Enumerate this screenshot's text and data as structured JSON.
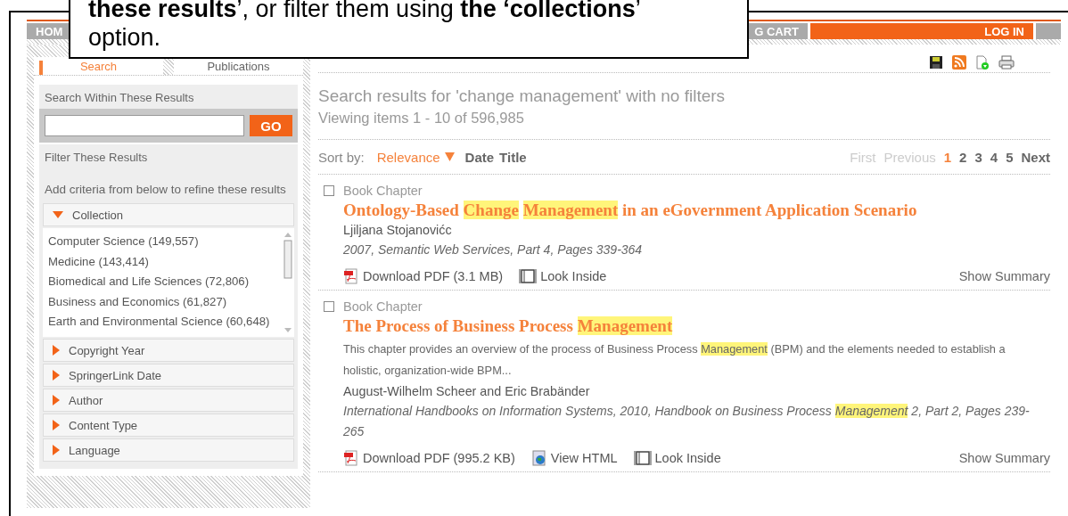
{
  "callout": {
    "text": "**these results**’, or filter them using **the ‘collections**’ option."
  },
  "nav": [
    {
      "label": "HOM",
      "kind": "plain"
    },
    {
      "label": "G CART",
      "kind": "plain"
    },
    {
      "label": "LOG IN",
      "kind": "accent"
    }
  ],
  "sidebar_tabs": [
    {
      "label": "Search",
      "selected": true
    },
    {
      "label": "Publications",
      "selected": false
    }
  ],
  "search_within": {
    "heading": "Search Within These Results",
    "button": "GO"
  },
  "filter": {
    "heading": "Filter These Results",
    "hint": "Add criteria from below to refine these results",
    "facets": [
      {
        "label": "Collection",
        "expanded": true,
        "items": [
          "Computer Science (149,557)",
          "Medicine (143,414)",
          "Biomedical and Life Sciences (72,806)",
          "Business and Economics (61,827)",
          "Earth and Environmental Science (60,648)"
        ]
      },
      {
        "label": "Copyright Year",
        "expanded": false
      },
      {
        "label": "SpringerLink Date",
        "expanded": false
      },
      {
        "label": "Author",
        "expanded": false
      },
      {
        "label": "Content Type",
        "expanded": false
      },
      {
        "label": "Language",
        "expanded": false
      }
    ]
  },
  "results": {
    "heading": "Search results for 'change management' with no filters",
    "count": "Viewing items 1 - 10 of 596,985"
  },
  "sort": {
    "label": "Sort by:",
    "options": [
      {
        "label": "Relevance",
        "selected": true
      },
      {
        "label": "Date",
        "selected": false
      },
      {
        "label": "Title",
        "selected": false
      }
    ]
  },
  "pagination": [
    {
      "label": "First",
      "kind": "disabled"
    },
    {
      "label": "Previous",
      "kind": "disabled"
    },
    {
      "label": "1",
      "kind": "current"
    },
    {
      "label": "2",
      "kind": "page"
    },
    {
      "label": "3",
      "kind": "page"
    },
    {
      "label": "4",
      "kind": "page"
    },
    {
      "label": "5",
      "kind": "page"
    },
    {
      "label": "Next",
      "kind": "page"
    }
  ],
  "items": [
    {
      "checked": false,
      "type": "Book Chapter",
      "title": [
        {
          "text": "Ontology-Based ",
          "highlight": false
        },
        {
          "text": "Change Management",
          "highlight": true
        },
        {
          "text": " in an eGovernment Application Scenario",
          "highlight": false
        }
      ],
      "authors": "Ljiljana Stojanovićc",
      "source": [
        {
          "text": "2007, Semantic Web Services, Part 4, Pages 339-364",
          "highlight": false
        }
      ],
      "links": [
        {
          "label": "Download PDF (3.1 MB)",
          "kind": "pdf"
        },
        {
          "label": "Look Inside",
          "kind": "look"
        }
      ],
      "summary": "Show Summary"
    },
    {
      "checked": false,
      "type": "Book Chapter",
      "title": [
        {
          "text": "The Process of Business Process ",
          "highlight": false
        },
        {
          "text": "Management",
          "highlight": true
        }
      ],
      "snippet": [
        {
          "text": "This chapter provides an overview of the process of Business Process ",
          "highlight": false
        },
        {
          "text": "Management",
          "highlight": true
        },
        {
          "text": " (BPM) and the elements needed to establish a holistic, organization-wide BPM...",
          "highlight": false
        }
      ],
      "authors": "August-Wilhelm Scheer and Eric Brabänder",
      "source": [
        {
          "text": "International Handbooks on Information Systems, 2010, Handbook on Business Process ",
          "highlight": false
        },
        {
          "text": "Management",
          "highlight": true
        },
        {
          "text": " 2, Part 2, Pages 239-265",
          "highlight": false
        }
      ],
      "links": [
        {
          "label": "Download PDF (995.2 KB)",
          "kind": "pdf"
        },
        {
          "label": "View HTML",
          "kind": "html"
        },
        {
          "label": "Look Inside",
          "kind": "look"
        }
      ],
      "summary": "Show Summary"
    }
  ]
}
